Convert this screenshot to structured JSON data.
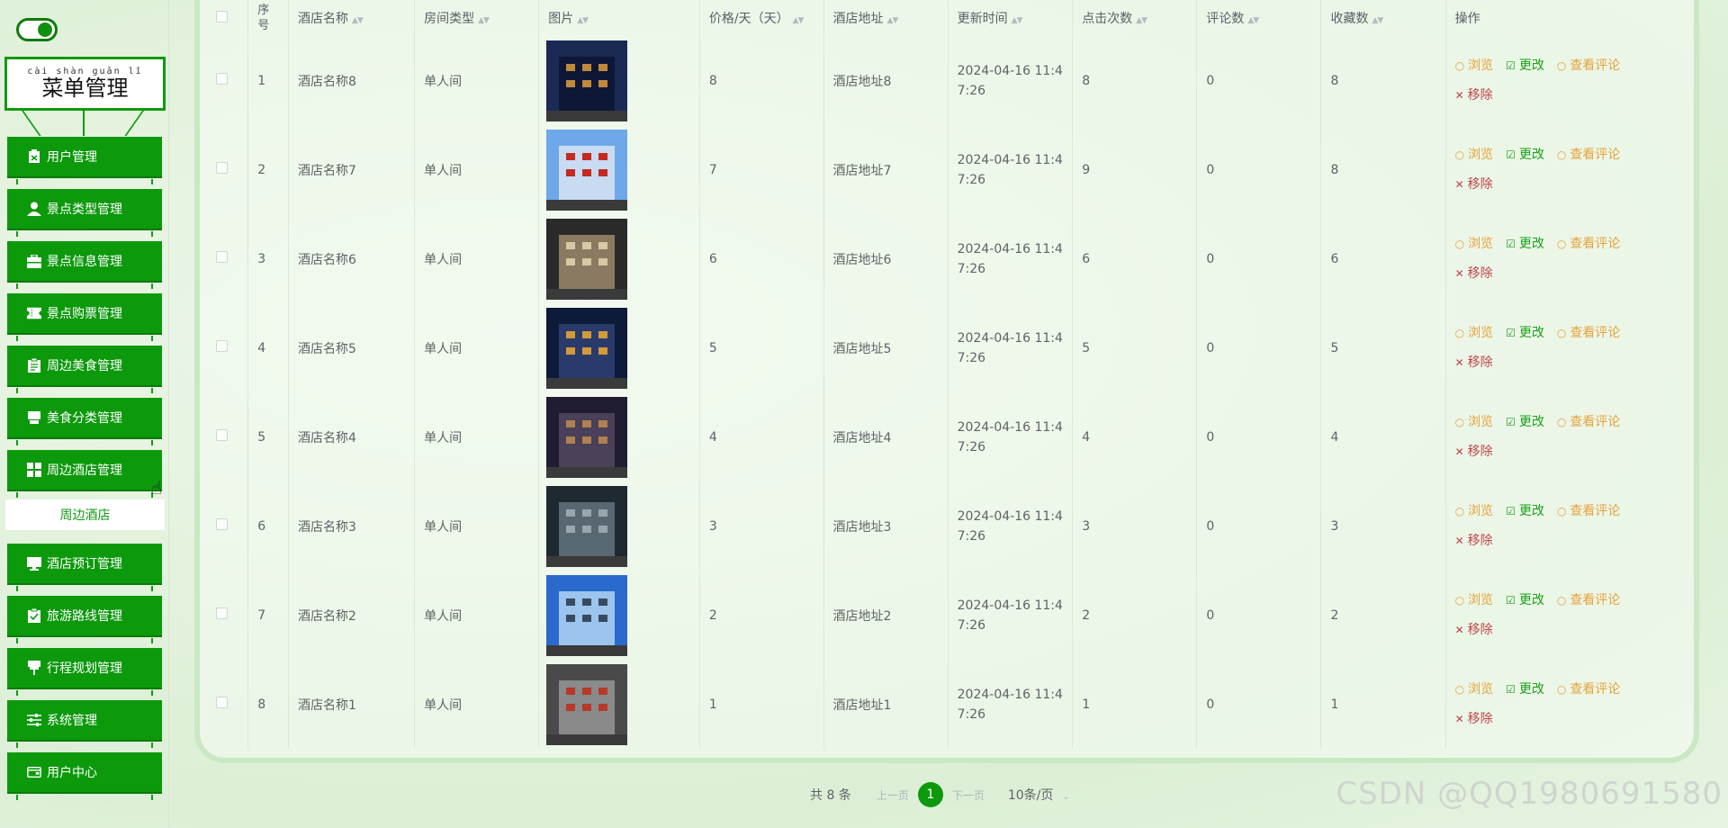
{
  "sidebar": {
    "title_pinyin": "cài shàn guǎn lǐ",
    "title": "菜单管理",
    "items": [
      {
        "label": "用户管理",
        "icon": "user-card-icon"
      },
      {
        "label": "景点类型管理",
        "icon": "person-icon"
      },
      {
        "label": "景点信息管理",
        "icon": "briefcase-icon"
      },
      {
        "label": "景点购票管理",
        "icon": "ticket-icon"
      },
      {
        "label": "周边美食管理",
        "icon": "clipboard-icon"
      },
      {
        "label": "美食分类管理",
        "icon": "tray-icon"
      },
      {
        "label": "周边酒店管理",
        "icon": "grid-icon"
      },
      {
        "label": "酒店预订管理",
        "icon": "monitor-icon"
      },
      {
        "label": "旅游路线管理",
        "icon": "checklist-icon"
      },
      {
        "label": "行程规划管理",
        "icon": "pin-icon"
      },
      {
        "label": "系统管理",
        "icon": "sliders-icon"
      },
      {
        "label": "用户中心",
        "icon": "wallet-icon"
      }
    ],
    "active_submenu": "周边酒店"
  },
  "table": {
    "headers": [
      "序号",
      "酒店名称",
      "房间类型",
      "图片",
      "价格/天（天）",
      "酒店地址",
      "更新时间",
      "点击次数",
      "评论数",
      "收藏数",
      "操作"
    ],
    "actions": {
      "view": "浏览",
      "edit": "更改",
      "comment": "查看评论",
      "remove": "移除"
    },
    "rows": [
      {
        "index": "1",
        "name": "酒店名称8",
        "room": "单人间",
        "price": "8",
        "address": "酒店地址8",
        "time1": "2024-04-16 11:4",
        "time2": "7:26",
        "clicks": "8",
        "comments": "0",
        "favorites": "8"
      },
      {
        "index": "2",
        "name": "酒店名称7",
        "room": "单人间",
        "price": "7",
        "address": "酒店地址7",
        "time1": "2024-04-16 11:4",
        "time2": "7:26",
        "clicks": "9",
        "comments": "0",
        "favorites": "8"
      },
      {
        "index": "3",
        "name": "酒店名称6",
        "room": "单人间",
        "price": "6",
        "address": "酒店地址6",
        "time1": "2024-04-16 11:4",
        "time2": "7:26",
        "clicks": "6",
        "comments": "0",
        "favorites": "6"
      },
      {
        "index": "4",
        "name": "酒店名称5",
        "room": "单人间",
        "price": "5",
        "address": "酒店地址5",
        "time1": "2024-04-16 11:4",
        "time2": "7:26",
        "clicks": "5",
        "comments": "0",
        "favorites": "5"
      },
      {
        "index": "5",
        "name": "酒店名称4",
        "room": "单人间",
        "price": "4",
        "address": "酒店地址4",
        "time1": "2024-04-16 11:4",
        "time2": "7:26",
        "clicks": "4",
        "comments": "0",
        "favorites": "4"
      },
      {
        "index": "6",
        "name": "酒店名称3",
        "room": "单人间",
        "price": "3",
        "address": "酒店地址3",
        "time1": "2024-04-16 11:4",
        "time2": "7:26",
        "clicks": "3",
        "comments": "0",
        "favorites": "3"
      },
      {
        "index": "7",
        "name": "酒店名称2",
        "room": "单人间",
        "price": "2",
        "address": "酒店地址2",
        "time1": "2024-04-16 11:4",
        "time2": "7:26",
        "clicks": "2",
        "comments": "0",
        "favorites": "2"
      },
      {
        "index": "8",
        "name": "酒店名称1",
        "room": "单人间",
        "price": "1",
        "address": "酒店地址1",
        "time1": "2024-04-16 11:4",
        "time2": "7:26",
        "clicks": "1",
        "comments": "0",
        "favorites": "1"
      }
    ]
  },
  "pagination": {
    "total": "共 8 条",
    "prev": "上一页",
    "current": "1",
    "next": "下一页",
    "page_size": "10条/页"
  },
  "watermark": "CSDN @QQ1980691580",
  "colors": {
    "accent": "#0c990c",
    "view": "#e6a23c",
    "edit": "#19a119",
    "remove": "#c0454a"
  }
}
